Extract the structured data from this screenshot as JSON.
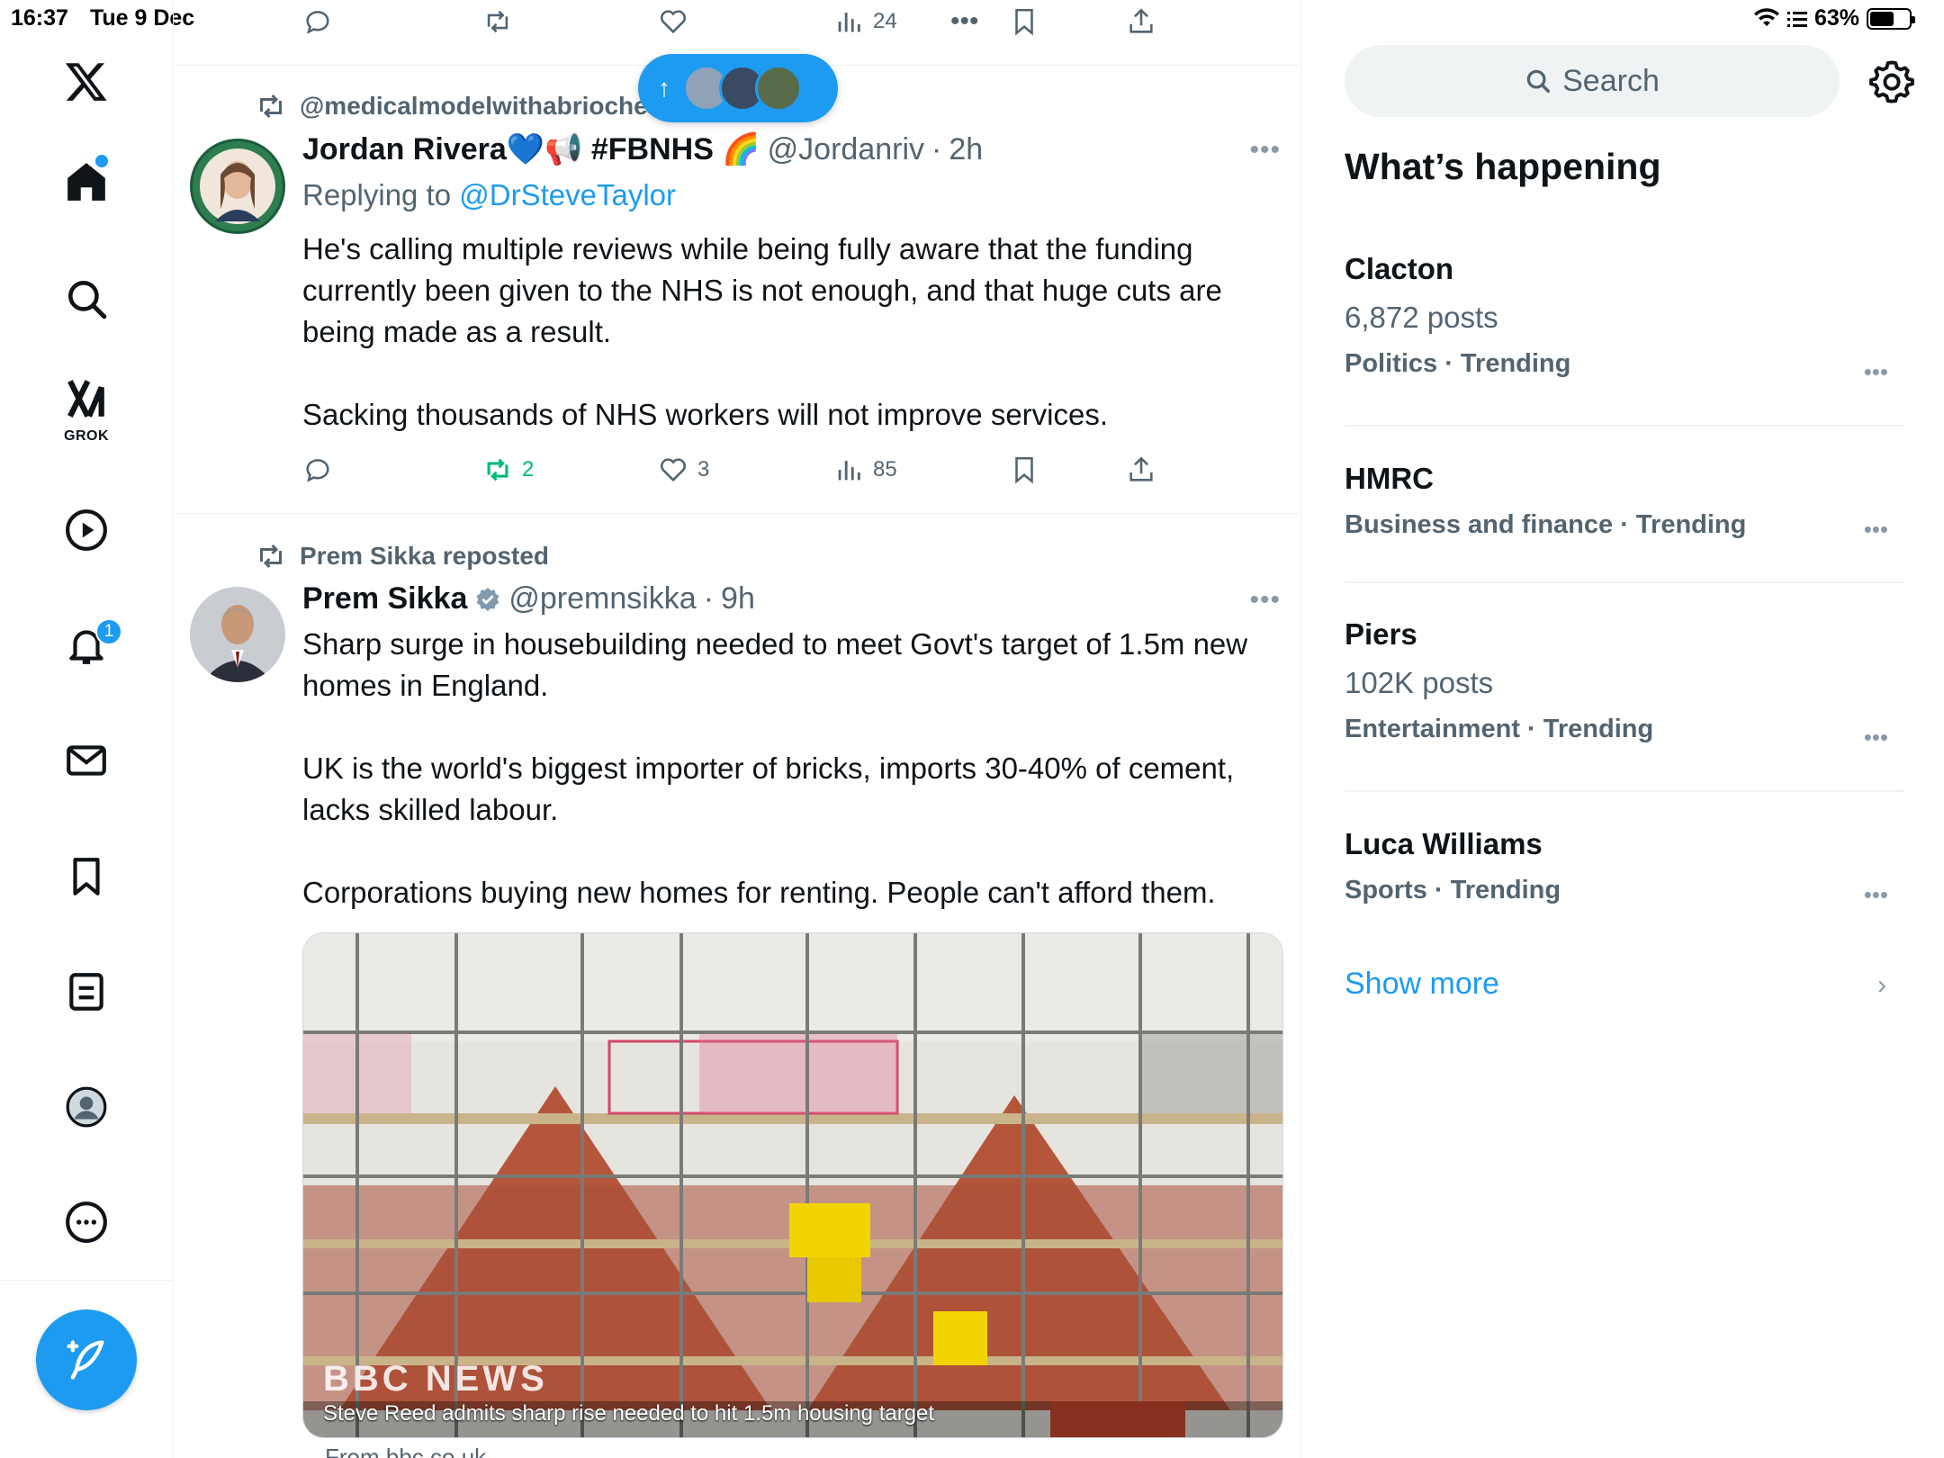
{
  "status_bar": {
    "time": "16:37",
    "date": "Tue 9 Dec",
    "battery": "63%",
    "battery_fraction": 0.63
  },
  "nav": {
    "items": [
      "x-logo-icon",
      "home-icon",
      "search-icon",
      "grok-icon",
      "video-icon",
      "notifications-icon",
      "messages-icon",
      "bookmarks-icon",
      "lists-icon",
      "profile-icon",
      "more-icon"
    ],
    "grok_label": "GROK",
    "notification_count": "1"
  },
  "top_action_row": {
    "views": "24"
  },
  "tweet1": {
    "reposted_by": "@medicalmodelwithabrioche reposted",
    "name": "Jordan Rivera💙📢 #FBNHS 🌈",
    "handle": "@Jordanriv",
    "time": "2h",
    "replying_label": "Replying to",
    "replying_to": "@DrSteveTaylor",
    "text": "He's calling multiple reviews while being fully aware that the funding currently been given to the NHS is not enough, and that huge cuts are being made as a result.\n\nSacking thousands of NHS workers will not improve services.",
    "reposts": "2",
    "likes": "3",
    "views": "85"
  },
  "tweet2": {
    "reposted_by": "Prem Sikka reposted",
    "name": "Prem Sikka",
    "handle": "@premnsikka",
    "time": "9h",
    "text": "Sharp surge in housebuilding needed to meet Govt's target of 1.5m new homes in England.\n\nUK is the world's biggest importer of bricks, imports 30-40% of cement, lacks skilled labour.\n\nCorporations buying new homes for renting. People can't afford them.",
    "media_brand": "BBC NEWS",
    "media_caption": "Steve Reed admits sharp rise needed to hit 1.5m housing target",
    "from": "From bbc.co.uk"
  },
  "sidebar": {
    "search_placeholder": "Search",
    "section_title": "What’s happening",
    "trends": [
      {
        "name": "Clacton",
        "count": "6,872 posts",
        "meta": "Politics · Trending"
      },
      {
        "name": "HMRC",
        "count": "",
        "meta": "Business and finance · Trending"
      },
      {
        "name": "Piers",
        "count": "102K posts",
        "meta": "Entertainment · Trending"
      },
      {
        "name": "Luca Williams",
        "count": "",
        "meta": "Sports · Trending"
      }
    ],
    "show_more": "Show more"
  },
  "colors": {
    "accent": "#1d9bf0",
    "repost_green": "#00ba7c",
    "secondary_text": "#536471"
  }
}
